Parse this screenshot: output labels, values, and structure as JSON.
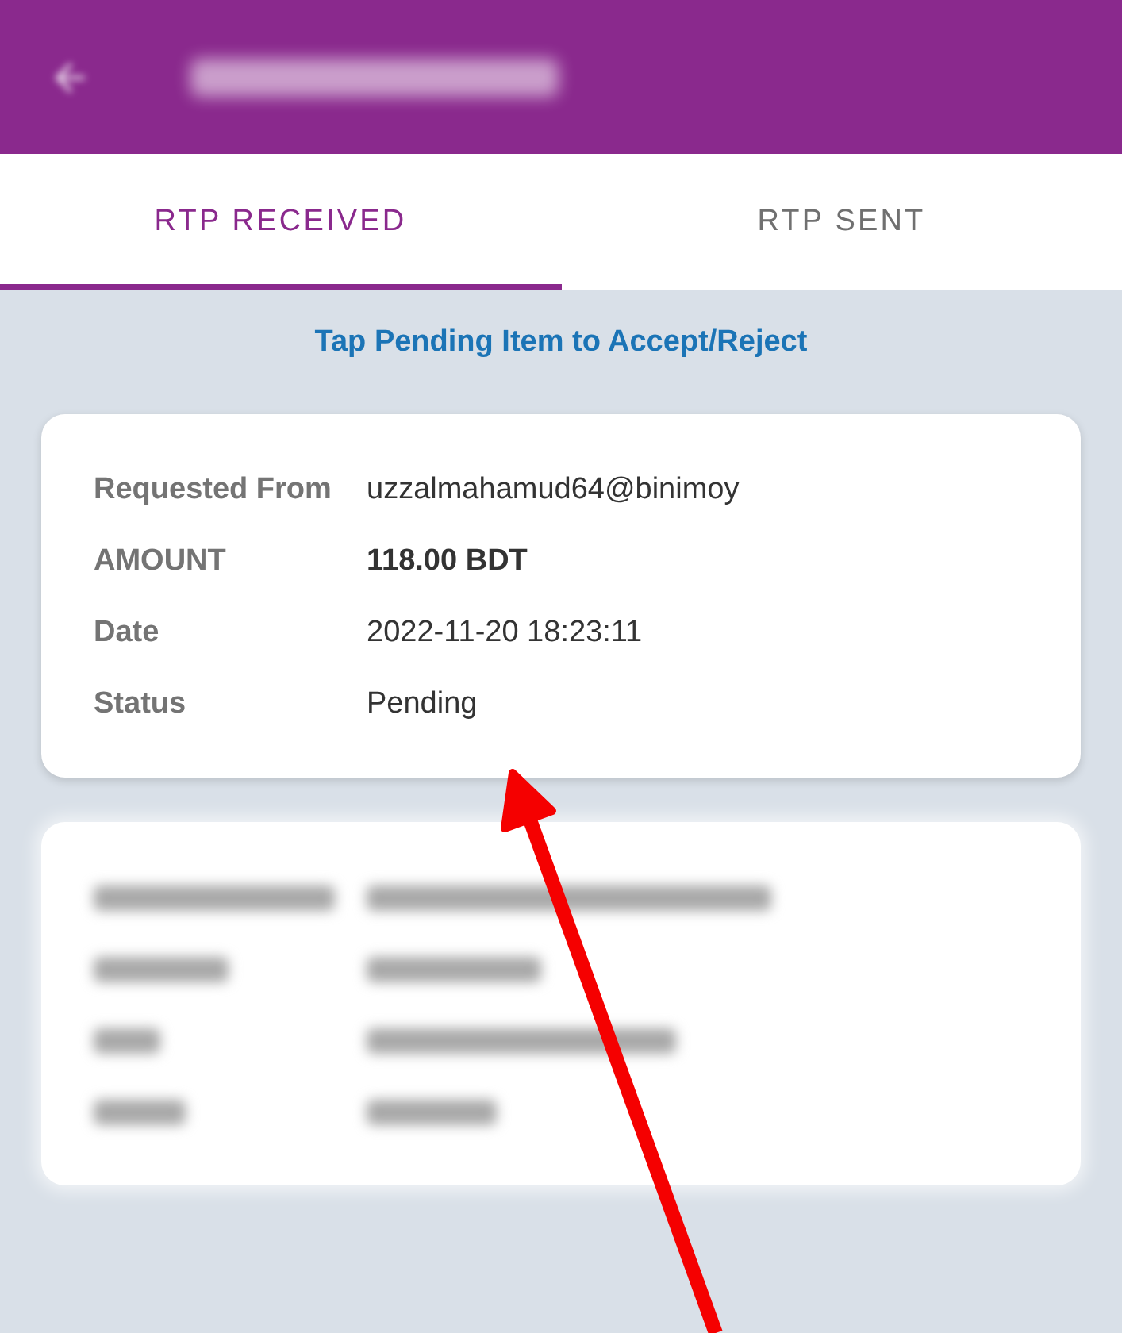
{
  "tabs": [
    {
      "label": "RTP RECEIVED",
      "selected": true
    },
    {
      "label": "RTP SENT",
      "selected": false
    }
  ],
  "hint": "Tap Pending Item to Accept/Reject",
  "requests": [
    {
      "kind": "visible",
      "fields": [
        {
          "kind": "text",
          "label": "Requested From",
          "value": "uzzalmahamud64@binimoy"
        },
        {
          "kind": "amount",
          "label": "AMOUNT",
          "value": "118.00 BDT"
        },
        {
          "kind": "text",
          "label": "Date",
          "value": "2022-11-20 18:23:11"
        },
        {
          "kind": "text",
          "label": "Status",
          "value": "Pending"
        }
      ]
    },
    {
      "kind": "blurred"
    }
  ]
}
